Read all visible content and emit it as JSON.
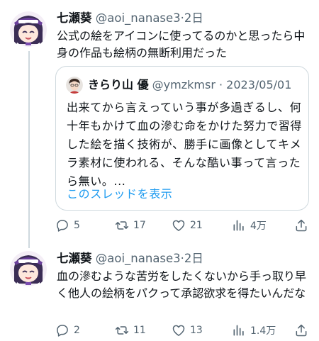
{
  "posts": [
    {
      "display_name": "七瀬葵",
      "handle_time": "@aoi_nanase3·2日",
      "text": "公式の絵をアイコンに使ってるのかと思ったら中身の作品も絵柄の無断利用だった",
      "avatar_icon": "anime-girl-avatar-icon",
      "quote": {
        "display_name": "きらり山 優",
        "handle_time": "@ymzkmsr · 2023/05/01",
        "text": "出来てから言えっていう事が多過ぎるし、何十年もかけて血の滲む命をかけた努力で習得した絵を描く技術が、勝手に画像としてキメラ素材に使われる、そんな酷い事って言ったら無い。...",
        "show_thread": "このスレッドを表示",
        "link_color": "#1d9bf0"
      },
      "actions": {
        "replies": "5",
        "reposts": "17",
        "likes": "21",
        "views": "4万"
      }
    },
    {
      "display_name": "七瀬葵",
      "handle_time": "@aoi_nanase3·2日",
      "text": "血の滲むような苦労をしたくないから手っ取り早く他人の絵柄をパクって承認欲求を得たいんだな",
      "avatar_icon": "anime-girl-avatar-icon",
      "actions": {
        "replies": "2",
        "reposts": "11",
        "likes": "13",
        "views": "1.4万"
      }
    }
  ],
  "colors": {
    "text": "#0f1419",
    "meta": "#536471",
    "border": "#cfd9de",
    "accent": "#1d9bf0"
  }
}
